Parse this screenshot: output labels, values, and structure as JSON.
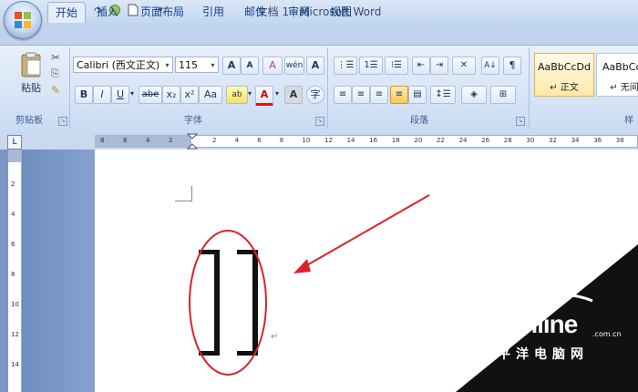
{
  "window": {
    "title": "文档 1 - Microsoft Word"
  },
  "tabs": [
    "开始",
    "插入",
    "页面布局",
    "引用",
    "邮件",
    "审阅",
    "视图"
  ],
  "ribbon": {
    "clipboard": {
      "paste_label": "粘贴",
      "group_label": "剪贴板"
    },
    "font": {
      "font_name": "Calibri (西文正文)",
      "font_size": "115",
      "group_label": "字体",
      "bold": "B",
      "italic": "I",
      "underline": "U",
      "strike": "abe",
      "sub": "x₂",
      "sup": "x²",
      "case": "Aa",
      "grow": "A",
      "shrink": "A",
      "clear": "A",
      "phonetic": "A"
    },
    "paragraph": {
      "group_label": "段落"
    },
    "styles": [
      {
        "sample": "AaBbCcDd",
        "name": "↵ 正文"
      },
      {
        "sample": "AaBbCcDd",
        "name": "↵ 无间隔"
      }
    ],
    "styles_group_label": "样"
  },
  "ruler": {
    "left_ticks": [
      "8",
      "6",
      "4",
      "2"
    ],
    "right_ticks": [
      "2",
      "4",
      "6",
      "8",
      "10",
      "12",
      "14",
      "16",
      "18",
      "20",
      "22",
      "24",
      "26",
      "28",
      "30",
      "32",
      "34",
      "36",
      "38"
    ],
    "vertical_ticks": [
      "2",
      "4",
      "6",
      "8",
      "10",
      "12",
      "14"
    ]
  },
  "document": {
    "bracket_text": "]]",
    "paragraph_mark": "↵"
  },
  "watermark": {
    "brand": "PConline",
    "suffix": ".com.cn",
    "chinese": "太平洋电脑网"
  },
  "colors": {
    "annotation_red": "#d9242b",
    "ribbon_blue": "#c3d6ef"
  }
}
